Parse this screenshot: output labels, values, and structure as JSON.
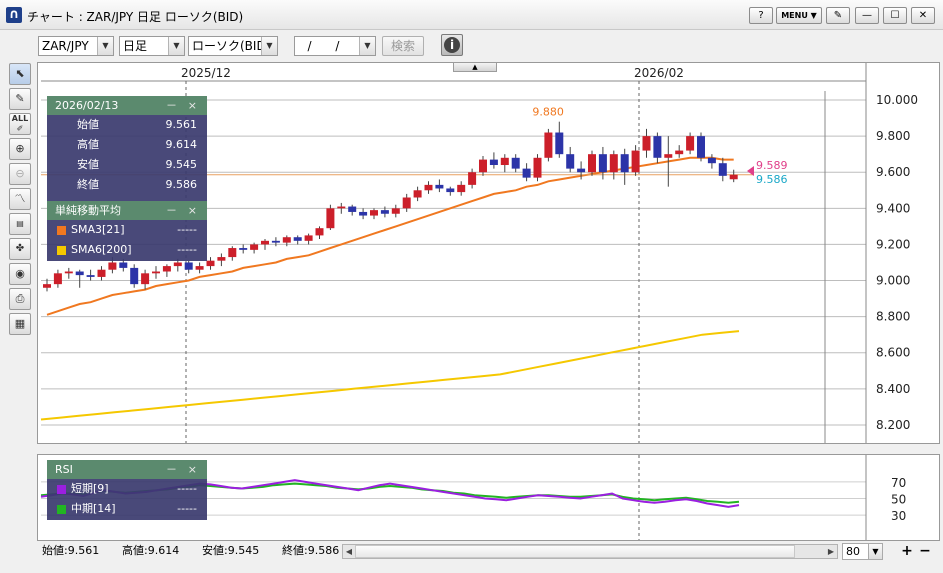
{
  "window": {
    "title": "チャート : ZAR/JPY 日足 ローソク(BID)",
    "buttons": [
      "?",
      "MENU ▼",
      "✎",
      "—",
      "☐",
      "✕"
    ]
  },
  "toolbar": {
    "pair": "ZAR/JPY",
    "period": "日足",
    "chart_type": "ローソク(BID)",
    "date_value": "/ /",
    "search_label": "検索",
    "info_label": "i"
  },
  "left_tools": [
    "cursor-tool",
    "pen-tool",
    "all-erase-tool",
    "zoom-in-tool",
    "zoom-out-tool",
    "indicator-tool",
    "numeric-tool",
    "symbol-tool",
    "view-tool",
    "print-tool",
    "table-tool"
  ],
  "left_tools_text": {
    "all": "ALL"
  },
  "chart": {
    "x_labels": [
      "2025/12",
      "2026/02"
    ],
    "y_ticks": [
      "10.000",
      "9.800",
      "9.600",
      "9.400",
      "9.200",
      "9.000",
      "8.800",
      "8.600",
      "8.400",
      "8.200"
    ],
    "high_label": "9.880",
    "price_red": "9.589",
    "price_blue": "9.586",
    "colors": {
      "up": "#cc1f2a",
      "down": "#2c34a8",
      "sma21": "#f07820",
      "sma200": "#f5c800",
      "rsi_short": "#9b1fe0",
      "rsi_long": "#22b522"
    }
  },
  "ohlc_panel": {
    "date": "2026/02/13",
    "rows": [
      {
        "label": "始値",
        "value": "9.561"
      },
      {
        "label": "高値",
        "value": "9.614"
      },
      {
        "label": "安値",
        "value": "9.545"
      },
      {
        "label": "終値",
        "value": "9.586"
      }
    ],
    "minimize": "－",
    "close": "×"
  },
  "sma_panel": {
    "title": "単純移動平均",
    "rows": [
      {
        "label": "SMA3[21]",
        "value": "-----"
      },
      {
        "label": "SMA6[200]",
        "value": "-----"
      }
    ],
    "minimize": "－",
    "close": "×"
  },
  "rsi_panel": {
    "title": "RSI",
    "rows": [
      {
        "label": "短期[9]",
        "value": "-----"
      },
      {
        "label": "中期[14]",
        "value": "-----"
      }
    ],
    "minimize": "－",
    "close": "×",
    "y_ticks": [
      "70",
      "50",
      "30"
    ]
  },
  "status": {
    "open": "始値:9.561",
    "high": "高値:9.614",
    "low": "安値:9.545",
    "close": "終値:9.586",
    "zoom": "80"
  },
  "chart_data": {
    "type": "candlestick",
    "ylim": [
      8.1,
      10.05
    ],
    "candles": [
      [
        8.96,
        9.01,
        8.94,
        8.98
      ],
      [
        8.98,
        9.06,
        8.96,
        9.04
      ],
      [
        9.04,
        9.07,
        9.01,
        9.05
      ],
      [
        9.05,
        9.06,
        8.96,
        9.03
      ],
      [
        9.03,
        9.06,
        9.0,
        9.02
      ],
      [
        9.02,
        9.08,
        9.0,
        9.06
      ],
      [
        9.06,
        9.13,
        9.04,
        9.1
      ],
      [
        9.1,
        9.12,
        9.05,
        9.07
      ],
      [
        9.07,
        9.09,
        8.96,
        8.98
      ],
      [
        8.98,
        9.06,
        8.95,
        9.04
      ],
      [
        9.04,
        9.08,
        9.01,
        9.05
      ],
      [
        9.05,
        9.09,
        9.02,
        9.08
      ],
      [
        9.08,
        9.12,
        9.05,
        9.1
      ],
      [
        9.1,
        9.11,
        9.04,
        9.06
      ],
      [
        9.06,
        9.1,
        9.04,
        9.08
      ],
      [
        9.08,
        9.13,
        9.06,
        9.11
      ],
      [
        9.11,
        9.15,
        9.08,
        9.13
      ],
      [
        9.13,
        9.19,
        9.11,
        9.18
      ],
      [
        9.18,
        9.2,
        9.15,
        9.17
      ],
      [
        9.17,
        9.21,
        9.15,
        9.2
      ],
      [
        9.2,
        9.23,
        9.17,
        9.22
      ],
      [
        9.22,
        9.24,
        9.19,
        9.21
      ],
      [
        9.21,
        9.25,
        9.19,
        9.24
      ],
      [
        9.24,
        9.25,
        9.2,
        9.22
      ],
      [
        9.22,
        9.26,
        9.2,
        9.25
      ],
      [
        9.25,
        9.3,
        9.23,
        9.29
      ],
      [
        9.29,
        9.42,
        9.28,
        9.4
      ],
      [
        9.4,
        9.43,
        9.37,
        9.41
      ],
      [
        9.41,
        9.42,
        9.36,
        9.38
      ],
      [
        9.38,
        9.4,
        9.34,
        9.36
      ],
      [
        9.36,
        9.4,
        9.34,
        9.39
      ],
      [
        9.39,
        9.41,
        9.35,
        9.37
      ],
      [
        9.37,
        9.42,
        9.35,
        9.4
      ],
      [
        9.4,
        9.48,
        9.38,
        9.46
      ],
      [
        9.46,
        9.52,
        9.44,
        9.5
      ],
      [
        9.5,
        9.55,
        9.48,
        9.53
      ],
      [
        9.53,
        9.56,
        9.49,
        9.51
      ],
      [
        9.51,
        9.52,
        9.47,
        9.49
      ],
      [
        9.49,
        9.55,
        9.47,
        9.53
      ],
      [
        9.53,
        9.62,
        9.51,
        9.6
      ],
      [
        9.6,
        9.69,
        9.58,
        9.67
      ],
      [
        9.67,
        9.71,
        9.62,
        9.64
      ],
      [
        9.64,
        9.7,
        9.6,
        9.68
      ],
      [
        9.68,
        9.7,
        9.6,
        9.62
      ],
      [
        9.62,
        9.65,
        9.55,
        9.57
      ],
      [
        9.57,
        9.7,
        9.55,
        9.68
      ],
      [
        9.68,
        9.84,
        9.66,
        9.82
      ],
      [
        9.82,
        9.88,
        9.68,
        9.7
      ],
      [
        9.7,
        9.74,
        9.6,
        9.62
      ],
      [
        9.62,
        9.66,
        9.56,
        9.6
      ],
      [
        9.6,
        9.72,
        9.58,
        9.7
      ],
      [
        9.7,
        9.74,
        9.56,
        9.6
      ],
      [
        9.6,
        9.72,
        9.56,
        9.7
      ],
      [
        9.7,
        9.73,
        9.53,
        9.6
      ],
      [
        9.6,
        9.75,
        9.58,
        9.72
      ],
      [
        9.72,
        9.84,
        9.68,
        9.8
      ],
      [
        9.8,
        9.82,
        9.65,
        9.68
      ],
      [
        9.68,
        9.8,
        9.52,
        9.7
      ],
      [
        9.7,
        9.75,
        9.68,
        9.72
      ],
      [
        9.72,
        9.82,
        9.7,
        9.8
      ],
      [
        9.8,
        9.82,
        9.66,
        9.68
      ],
      [
        9.68,
        9.7,
        9.62,
        9.65
      ],
      [
        9.65,
        9.68,
        9.55,
        9.58
      ],
      [
        9.561,
        9.614,
        9.545,
        9.586
      ]
    ],
    "sma21": [
      8.81,
      8.83,
      8.85,
      8.87,
      8.88,
      8.9,
      8.92,
      8.93,
      8.94,
      8.95,
      8.97,
      8.98,
      8.99,
      9.0,
      9.02,
      9.03,
      9.04,
      9.05,
      9.07,
      9.08,
      9.09,
      9.1,
      9.12,
      9.13,
      9.14,
      9.16,
      9.18,
      9.2,
      9.22,
      9.24,
      9.26,
      9.28,
      9.3,
      9.32,
      9.34,
      9.36,
      9.38,
      9.4,
      9.42,
      9.44,
      9.46,
      9.48,
      9.49,
      9.5,
      9.52,
      9.53,
      9.55,
      9.56,
      9.57,
      9.58,
      9.59,
      9.6,
      9.61,
      9.62,
      9.63,
      9.64,
      9.65,
      9.66,
      9.67,
      9.68,
      9.68,
      9.68,
      9.67,
      9.67
    ],
    "sma200": [
      8.23,
      8.24,
      8.25,
      8.26,
      8.27,
      8.28,
      8.29,
      8.3,
      8.31,
      8.32,
      8.33,
      8.34,
      8.35,
      8.36,
      8.37,
      8.38,
      8.39,
      8.4,
      8.41,
      8.42,
      8.43,
      8.44,
      8.45,
      8.46,
      8.47,
      8.48,
      8.5,
      8.52,
      8.54,
      8.56,
      8.58,
      8.6,
      8.62,
      8.64,
      8.66,
      8.68,
      8.7,
      8.71,
      8.72
    ],
    "rsi_short": [
      52,
      54,
      56,
      55,
      53,
      57,
      60,
      58,
      56,
      57,
      58,
      60,
      62,
      64,
      66,
      68,
      67,
      65,
      63,
      62,
      64,
      66,
      68,
      70,
      72,
      70,
      68,
      66,
      64,
      62,
      60,
      63,
      66,
      68,
      66,
      64,
      62,
      60,
      58,
      56,
      54,
      52,
      50,
      49,
      48,
      50,
      52,
      54,
      53,
      52,
      51,
      50,
      52,
      54,
      56,
      50,
      48,
      46,
      45,
      46,
      48,
      49,
      47,
      44,
      42,
      40,
      42
    ],
    "rsi_long": [
      54,
      55,
      56,
      56,
      55,
      57,
      59,
      58,
      57,
      58,
      59,
      60,
      61,
      63,
      64,
      66,
      65,
      64,
      63,
      62,
      63,
      64,
      66,
      67,
      68,
      67,
      66,
      65,
      63,
      62,
      61,
      62,
      64,
      65,
      64,
      63,
      61,
      60,
      59,
      57,
      56,
      54,
      53,
      52,
      51,
      52,
      53,
      54,
      54,
      53,
      52,
      52,
      53,
      54,
      55,
      52,
      50,
      49,
      48,
      49,
      50,
      51,
      49,
      47,
      46,
      45,
      46
    ]
  }
}
